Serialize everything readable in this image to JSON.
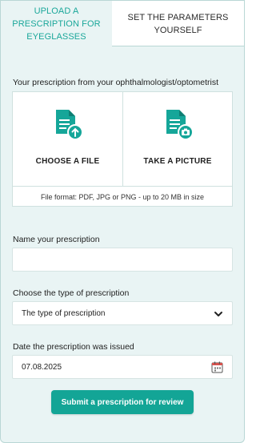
{
  "tabs": [
    {
      "label_line1": "UPLOAD A",
      "label_line2": "PRESCRIPTION FOR",
      "label_line3": "EYEGLASSES",
      "active": true
    },
    {
      "label_line1": "SET THE PARAMETERS",
      "label_line2": "YOURSELF",
      "active": false
    }
  ],
  "upload": {
    "heading": "Your prescription from your ophthalmologist/optometrist",
    "choose_file": "CHOOSE A FILE",
    "take_picture": "TAKE A PICTURE",
    "file_format": "File format: PDF, JPG or PNG - up to 20 MB in size"
  },
  "form": {
    "name_label": "Name your prescription",
    "name_value": "",
    "type_label": "Choose the type of prescription",
    "type_selected": "The type of prescription",
    "date_label": "Date the prescription was issued",
    "date_value": "07.08.2025",
    "submit_label": "Submit a prescription for review"
  },
  "colors": {
    "accent": "#13a596",
    "panel_bg": "#e9f4f4",
    "icon": "#15a699"
  },
  "icons": {
    "choose_file": "file-upload-icon",
    "take_picture": "file-camera-icon",
    "select": "chevron-down-icon",
    "date": "calendar-icon"
  }
}
